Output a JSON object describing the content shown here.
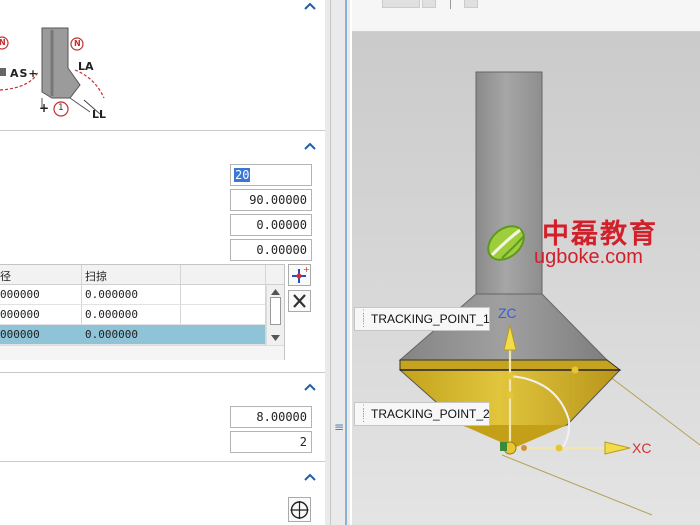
{
  "diagram": {
    "n_marker_left": "N",
    "n_marker_right": "N",
    "as_label": "AS+",
    "la_label": "LA",
    "ll_label": "LL",
    "plus_label": "+",
    "one_marker": "1"
  },
  "fields": {
    "tip_value": "20",
    "value_2": "90.00000",
    "value_3": "0.00000",
    "value_4": "0.00000",
    "value_5": "8.00000",
    "value_6": "2"
  },
  "table": {
    "columns": [
      "径",
      "扫掠",
      ""
    ],
    "rows": [
      {
        "col1": "000000",
        "col2": "0.000000",
        "selected": false
      },
      {
        "col1": "000000",
        "col2": "0.000000",
        "selected": false
      },
      {
        "col1": "000000",
        "col2": "0.000000",
        "selected": true
      }
    ]
  },
  "viewport": {
    "tracking_point_1": "TRACKING_POINT_1",
    "tracking_point_2": "TRACKING_POINT_2",
    "axis_z": "ZC",
    "axis_x": "XC",
    "watermark_cn": "中磊教育",
    "watermark_url": "ugboke.com"
  },
  "icons": [
    "chevron-up-icon",
    "add-point-icon",
    "delete-x-icon",
    "circle-crosshair-icon"
  ],
  "colors": {
    "selected_row": "#8fc3d7",
    "tool_yellow": "#d9bb2f",
    "axis_blue": "#3a5fd0",
    "axis_red": "#d63030",
    "brand_red": "#d2202b"
  }
}
